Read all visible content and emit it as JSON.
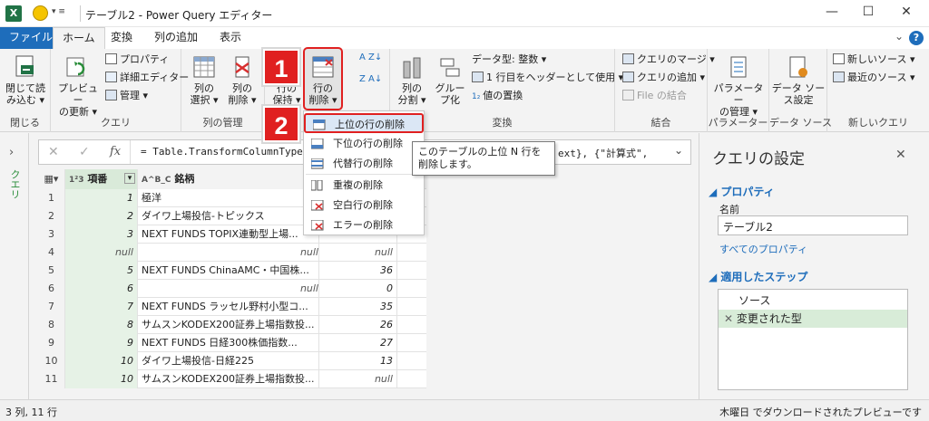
{
  "window": {
    "title": "テーブル2 - Power Query エディター",
    "app_icon": "X",
    "min": "—",
    "max": "☐",
    "close": "✕"
  },
  "tabs": [
    {
      "label": "ファイル"
    },
    {
      "label": "ホーム"
    },
    {
      "label": "変換"
    },
    {
      "label": "列の追加"
    },
    {
      "label": "表示"
    }
  ],
  "ribbon": {
    "close": {
      "btn": "閉じて読\nみ込む",
      "group": "閉じる"
    },
    "query": {
      "preview": "プレビュー\nの更新",
      "properties": "プロパティ",
      "advanced_editor": "詳細エディター",
      "manage": "管理",
      "group": "クエリ"
    },
    "columns": {
      "choose": "列の\n選択",
      "remove": "列の\n削除",
      "group": "列の管理"
    },
    "rows": {
      "keep": "行の\n保持",
      "remove": "行の\n削除"
    },
    "sort": {
      "az": "A Z",
      "za": "Z A"
    },
    "transform": {
      "split": "列の\n分割",
      "group_by": "グルー\nプ化",
      "data_type": "データ型: 整数",
      "first_row_header": "1 行目をヘッダーとして使用",
      "replace_values": "値の置換",
      "group": "変換"
    },
    "combine": {
      "merge": "クエリのマージ",
      "append": "クエリの追加",
      "combine_files": "File の結合",
      "group": "結合"
    },
    "params": {
      "manage": "パラメーター\nの管理",
      "group": "パラメーター"
    },
    "datasource": {
      "settings": "データ ソー\nス設定",
      "group": "データ ソース"
    },
    "newquery": {
      "new_source": "新しいソース",
      "recent": "最近のソース",
      "group": "新しいクエリ"
    }
  },
  "badges": {
    "one": "1",
    "two": "2"
  },
  "dropdown": {
    "items": [
      {
        "label": "上位の行の削除"
      },
      {
        "label": "下位の行の削除"
      },
      {
        "label": "代替行の削除"
      },
      {
        "label": "重複の削除"
      },
      {
        "label": "空白行の削除"
      },
      {
        "label": "エラーの削除"
      }
    ]
  },
  "tooltip": {
    "text": "このテーブルの上位 N 行を削除します。"
  },
  "formula": {
    "fx": "fx",
    "text": "= Table.TransformColumnTypes",
    "tail": "ext}, {\"計算式\","
  },
  "leftpane": {
    "label": "クエリ"
  },
  "grid": {
    "headers": {
      "col1_type": "1²3",
      "col1": "項番",
      "col2_type": "A^B_C",
      "col2": "銘柄"
    },
    "rows": [
      {
        "n": "1",
        "a": "1",
        "b": "極洋",
        "c": ""
      },
      {
        "n": "2",
        "a": "2",
        "b": "ダイワ上場投信-トピックス",
        "c": ""
      },
      {
        "n": "3",
        "a": "3",
        "b": "NEXT FUNDS TOPIX連動型上場...",
        "c": ""
      },
      {
        "n": "4",
        "a": "null",
        "b": "null",
        "c": "null"
      },
      {
        "n": "5",
        "a": "5",
        "b": "NEXT FUNDS ChinaAMC・中国株...",
        "c": "36"
      },
      {
        "n": "6",
        "a": "6",
        "b": "null",
        "c": "0"
      },
      {
        "n": "7",
        "a": "7",
        "b": "NEXT FUNDS ラッセル野村小型コ...",
        "c": "35"
      },
      {
        "n": "8",
        "a": "8",
        "b": "サムスンKODEX200証券上場指数投...",
        "c": "26"
      },
      {
        "n": "9",
        "a": "9",
        "b": "NEXT FUNDS 日経300株価指数...",
        "c": "27"
      },
      {
        "n": "10",
        "a": "10",
        "b": "ダイワ上場投信-日経225",
        "c": "13"
      },
      {
        "n": "11",
        "a": "10",
        "b": "サムスンKODEX200証券上場指数投...",
        "c": "null"
      }
    ]
  },
  "settings": {
    "title": "クエリの設定",
    "properties_heading": "プロパティ",
    "name_label": "名前",
    "name_value": "テーブル2",
    "all_properties": "すべてのプロパティ",
    "steps_heading": "適用したステップ",
    "steps": [
      {
        "label": "ソース"
      },
      {
        "label": "変更された型"
      }
    ]
  },
  "status": {
    "left": "3 列, 11 行",
    "right": "木曜日 でダウンロードされたプレビューです"
  },
  "colors": {
    "accent": "#1e6dbb",
    "hint_red": "#e02020",
    "excel_green": "#217346"
  }
}
